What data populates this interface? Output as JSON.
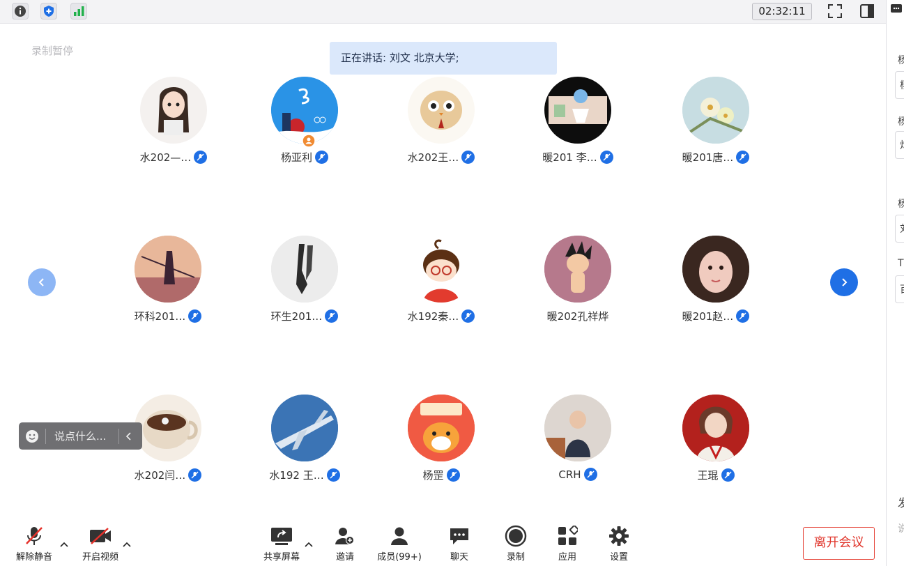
{
  "topbar": {
    "info_icon": "info-icon",
    "shield_icon": "shield-icon",
    "signal_icon": "signal-icon",
    "timer": "02:32:11",
    "fullscreen_icon": "fullscreen-icon",
    "sidebar_icon": "sidebar-toggle-icon"
  },
  "recording_status": "录制暂停",
  "speaker_banner": "正在讲话: 刘文 北京大学;",
  "participants": [
    {
      "name": "水202—…",
      "muted": true
    },
    {
      "name": "杨亚利",
      "muted": true,
      "host": true
    },
    {
      "name": "水202王…",
      "muted": true
    },
    {
      "name": "暖201 李…",
      "muted": true
    },
    {
      "name": "暖201唐…",
      "muted": true
    },
    {
      "name": "环科201…",
      "muted": true
    },
    {
      "name": "环生201…",
      "muted": true
    },
    {
      "name": "水192秦…",
      "muted": true
    },
    {
      "name": "暖202孔祥烨",
      "muted": false
    },
    {
      "name": "暖201赵…",
      "muted": true
    },
    {
      "name": "水202闫…",
      "muted": true
    },
    {
      "name": "水192 王…",
      "muted": true
    },
    {
      "name": "杨罡",
      "muted": true
    },
    {
      "name": "CRH",
      "muted": true
    },
    {
      "name": "王琨",
      "muted": true
    }
  ],
  "chat_input": {
    "placeholder": "说点什么..."
  },
  "toolbar": {
    "unmute": "解除静音",
    "start_video": "开启视频",
    "share_screen": "共享屏幕",
    "invite": "邀请",
    "members": "成员(99+)",
    "chat": "聊天",
    "record": "录制",
    "apps": "应用",
    "settings": "设置",
    "leave": "离开会议"
  },
  "right_panel": {
    "labels": [
      "杨",
      "杨",
      "杨",
      "T"
    ],
    "inputs": [
      "杨",
      "炸",
      "刘",
      "百"
    ],
    "bottom": [
      "发",
      "说"
    ]
  },
  "colors": {
    "accent": "#1f6fe5",
    "leave": "#e0352b",
    "speaker_bg": "#dbe8fb"
  }
}
